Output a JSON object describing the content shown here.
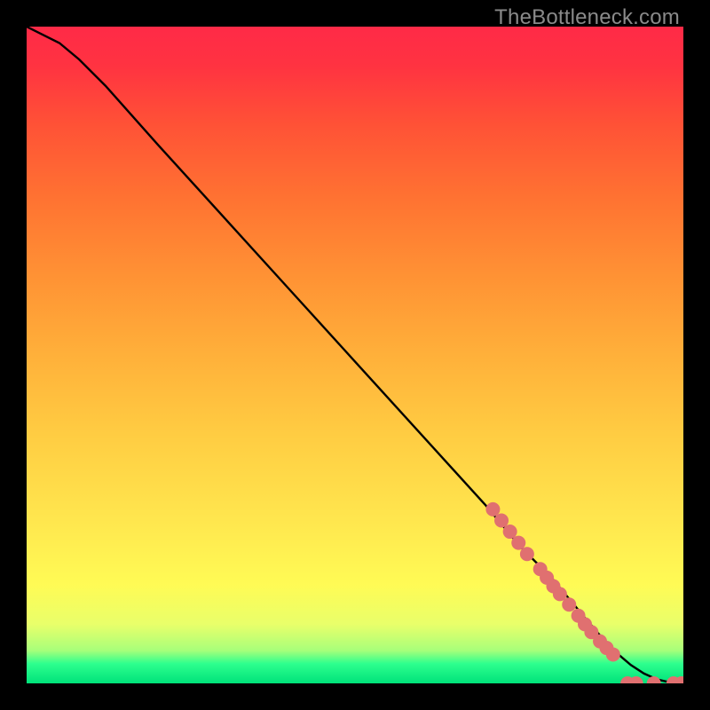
{
  "watermark": "TheBottleneck.com",
  "chart_data": {
    "type": "line",
    "title": "",
    "xlabel": "",
    "ylabel": "",
    "xlim": [
      0,
      100
    ],
    "ylim": [
      0,
      100
    ],
    "grid": false,
    "series": [
      {
        "name": "curve",
        "color": "#000000",
        "x": [
          0,
          2,
          5,
          8,
          12,
          20,
          30,
          40,
          50,
          60,
          70,
          75,
          80,
          85,
          88,
          90,
          92,
          94,
          96,
          98,
          100
        ],
        "y": [
          100,
          99,
          97.5,
          95,
          91,
          82,
          71,
          60,
          49,
          38,
          27,
          21,
          16,
          10,
          6.5,
          4.5,
          2.8,
          1.5,
          0.6,
          0.15,
          0
        ]
      }
    ],
    "markers": {
      "color": "#e07070",
      "radius_px": 8,
      "points": [
        {
          "x": 71.0,
          "y": 26.5
        },
        {
          "x": 72.3,
          "y": 24.8
        },
        {
          "x": 73.6,
          "y": 23.1
        },
        {
          "x": 74.9,
          "y": 21.4
        },
        {
          "x": 76.2,
          "y": 19.7
        },
        {
          "x": 78.2,
          "y": 17.4
        },
        {
          "x": 79.2,
          "y": 16.1
        },
        {
          "x": 80.2,
          "y": 14.8
        },
        {
          "x": 81.2,
          "y": 13.6
        },
        {
          "x": 82.6,
          "y": 12.0
        },
        {
          "x": 84.0,
          "y": 10.3
        },
        {
          "x": 85.0,
          "y": 9.0
        },
        {
          "x": 86.0,
          "y": 7.8
        },
        {
          "x": 87.3,
          "y": 6.4
        },
        {
          "x": 88.3,
          "y": 5.4
        },
        {
          "x": 89.3,
          "y": 4.4
        },
        {
          "x": 91.5,
          "y": 0.0
        },
        {
          "x": 92.8,
          "y": 0.0
        },
        {
          "x": 95.5,
          "y": 0.0
        },
        {
          "x": 98.5,
          "y": 0.0
        },
        {
          "x": 99.7,
          "y": 0.0
        }
      ]
    }
  }
}
